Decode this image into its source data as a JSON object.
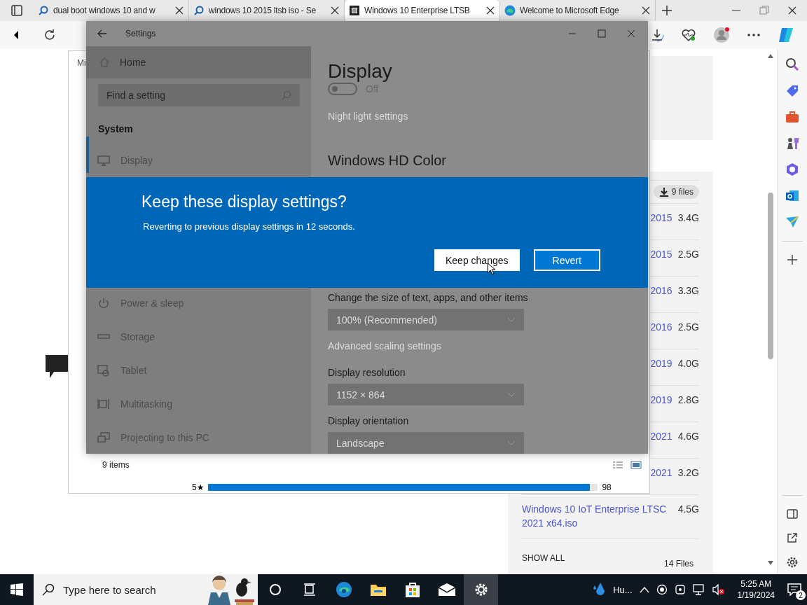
{
  "browser": {
    "tabs": [
      {
        "title": "dual boot windows 10 and w",
        "selected": false
      },
      {
        "title": "windows 10 2015 ltsb iso - Se",
        "selected": false
      },
      {
        "title": "Windows 10 Enterprise LTSB",
        "selected": true
      },
      {
        "title": "Welcome to Microsoft Edge",
        "selected": false
      }
    ]
  },
  "explorer_window": {
    "title": "Mi",
    "status": "9 items",
    "rating": {
      "label": "5★",
      "level": 0.98,
      "count": "98"
    }
  },
  "web_page": {
    "files_chip": "9 files",
    "files": [
      {
        "name": "2015",
        "size": "3.4G"
      },
      {
        "name": "2015",
        "size": "2.5G"
      },
      {
        "name": "2016",
        "size": "3.3G"
      },
      {
        "name": "2016",
        "size": "2.5G"
      },
      {
        "name": "2019",
        "size": "4.0G"
      },
      {
        "name": "2019",
        "size": "2.8G"
      },
      {
        "name": "2021",
        "size": "4.6G"
      },
      {
        "name": "2021",
        "size": "3.2G"
      },
      {
        "name": "Windows 10 IoT Enterprise LTSC 2021 x64.iso",
        "size": "4.5G"
      }
    ],
    "show_all": "SHOW ALL",
    "file_count": "14 Files"
  },
  "settings": {
    "title": "Settings",
    "home": "Home",
    "search_placeholder": "Find a setting",
    "section": "System",
    "nav": [
      {
        "label": "Display",
        "kind": "display",
        "selected": true
      },
      {
        "label": "Power & sleep",
        "kind": "power",
        "selected": false
      },
      {
        "label": "Storage",
        "kind": "storage",
        "selected": false
      },
      {
        "label": "Tablet",
        "kind": "tablet",
        "selected": false
      },
      {
        "label": "Multitasking",
        "kind": "multitasking",
        "selected": false
      },
      {
        "label": "Projecting to this PC",
        "kind": "projecting",
        "selected": false
      }
    ],
    "page_title": "Display",
    "night_light": {
      "on": false,
      "state_label": "Off"
    },
    "night_light_link": "Night light settings",
    "hd_color_title": "Windows HD Color",
    "scale_label": "Change the size of text, apps, and other items",
    "scale_value": "100% (Recommended)",
    "advanced_link": "Advanced scaling settings",
    "resolution_label": "Display resolution",
    "resolution_value": "1152 × 864",
    "orientation_label": "Display orientation",
    "orientation_value": "Landscape"
  },
  "dialog": {
    "title": "Keep these display settings?",
    "message": "Reverting to previous display settings in 12 seconds.",
    "buttons": [
      {
        "label": "Keep changes",
        "kind": "secondary"
      },
      {
        "label": "Revert",
        "kind": "primary"
      }
    ]
  },
  "taskbar": {
    "search_placeholder": "Type here to search",
    "apps": [
      {
        "kind": "cortana",
        "active": false
      },
      {
        "kind": "taskview",
        "active": false
      },
      {
        "kind": "edge",
        "active": false
      },
      {
        "kind": "explorer",
        "active": false
      },
      {
        "kind": "store",
        "active": false
      },
      {
        "kind": "mail",
        "active": false
      },
      {
        "kind": "settings",
        "active": true
      }
    ],
    "weather": "Hu...",
    "time": "5:25 AM",
    "date": "1/19/2024",
    "notifications": "2"
  }
}
